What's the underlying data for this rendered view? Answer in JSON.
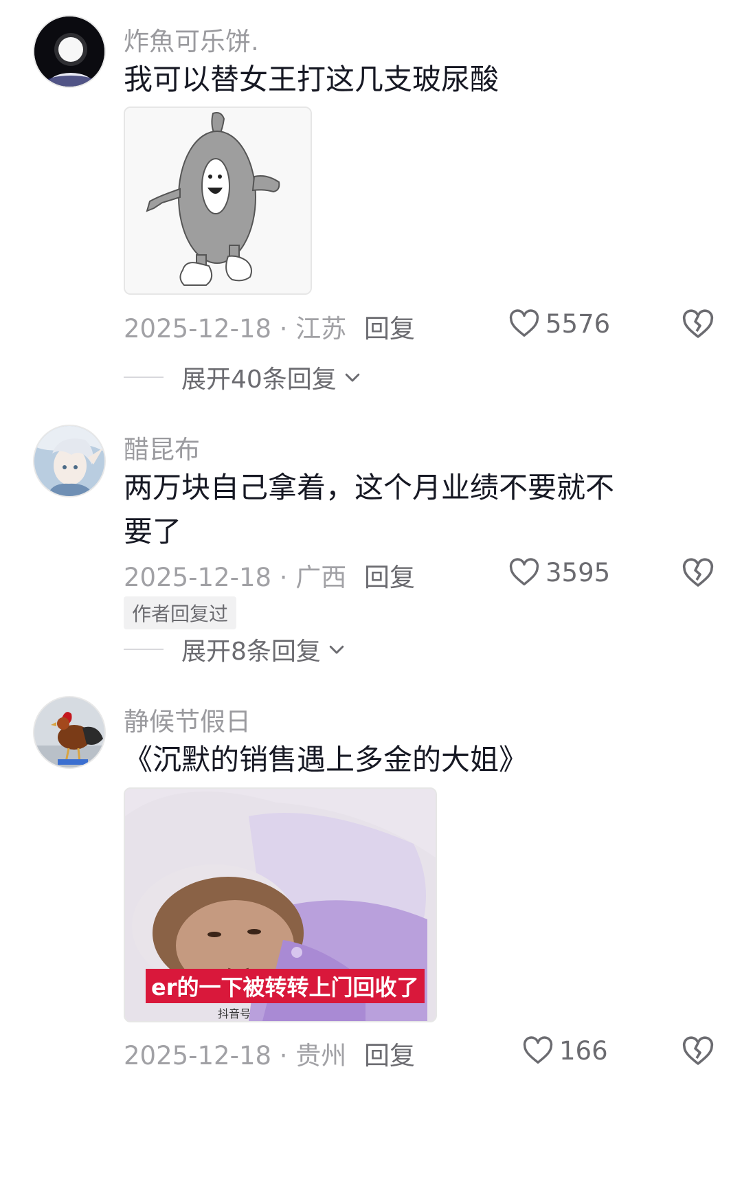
{
  "comments": [
    {
      "username": "炸魚可乐饼.",
      "text": "我可以替女王打这几支玻尿酸",
      "date_location": "2025-12-18 · 江苏",
      "reply_label": "回复",
      "likes": "5576",
      "expand_label": "展开40条回复"
    },
    {
      "username": "醋昆布",
      "text": "两万块自己拿着，这个月业绩不要就不要了",
      "date_location": "2025-12-18 · 广西",
      "reply_label": "回复",
      "likes": "3595",
      "author_tag": "作者回复过",
      "expand_label": "展开8条回复"
    },
    {
      "username": "静候节假日",
      "text": "《沉默的销售遇上多金的大姐》",
      "date_location": "2025-12-18 · 贵州",
      "reply_label": "回复",
      "likes": "166",
      "image_caption": "er的一下被转转上门回收了",
      "image_watermark": "抖音号"
    }
  ],
  "icons": {
    "like": "heart-outline-icon",
    "dislike": "broken-heart-icon",
    "expand": "chevron-down-icon"
  },
  "colors": {
    "caption_bg": "#d9183b",
    "meta_text": "#a1a1a5"
  }
}
